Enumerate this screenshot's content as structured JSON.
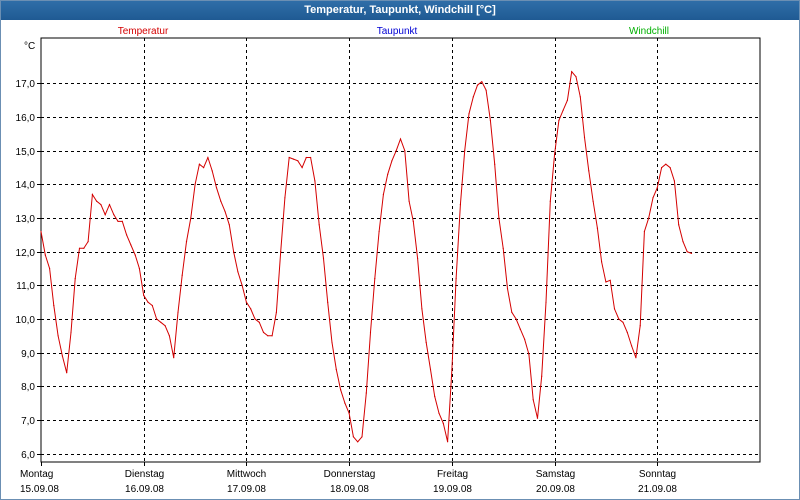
{
  "window": {
    "title": "Temperatur, Taupunkt, Windchill [°C]"
  },
  "chart_data": {
    "type": "line",
    "title": "Temperatur, Taupunkt, Windchill [°C]",
    "ylabel": "°C",
    "ylim": [
      5.75,
      18.35
    ],
    "yticks": [
      "6,0",
      "7,0",
      "8,0",
      "9,0",
      "10,0",
      "11,0",
      "12,0",
      "13,0",
      "14,0",
      "15,0",
      "16,0",
      "17,0"
    ],
    "xlim": [
      0,
      168
    ],
    "xticks": [
      {
        "day": "Montag",
        "date": "15.09.08",
        "x": 0
      },
      {
        "day": "Dienstag",
        "date": "16.09.08",
        "x": 24
      },
      {
        "day": "Mittwoch",
        "date": "17.09.08",
        "x": 48
      },
      {
        "day": "Donnerstag",
        "date": "18.09.08",
        "x": 72
      },
      {
        "day": "Freitag",
        "date": "19.09.08",
        "x": 96
      },
      {
        "day": "Samstag",
        "date": "20.09.08",
        "x": 120
      },
      {
        "day": "Sonntag",
        "date": "21.09.08",
        "x": 144
      }
    ],
    "grid": true,
    "legend": [
      {
        "label": "Temperatur",
        "color": "#d40000"
      },
      {
        "label": "Taupunkt",
        "color": "#0000d4"
      },
      {
        "label": "Windchill",
        "color": "#00b000"
      }
    ],
    "series": [
      {
        "name": "Temperatur",
        "color": "#d40000",
        "points": [
          [
            0,
            12.6
          ],
          [
            1,
            11.9
          ],
          [
            2,
            11.5
          ],
          [
            3,
            10.4
          ],
          [
            4,
            9.5
          ],
          [
            5,
            8.9
          ],
          [
            6,
            8.4
          ],
          [
            7,
            9.6
          ],
          [
            8,
            11.2
          ],
          [
            9,
            12.1
          ],
          [
            10,
            12.1
          ],
          [
            11,
            12.3
          ],
          [
            12,
            13.7
          ],
          [
            13,
            13.5
          ],
          [
            14,
            13.4
          ],
          [
            15,
            13.1
          ],
          [
            16,
            13.4
          ],
          [
            17,
            13.1
          ],
          [
            18,
            12.9
          ],
          [
            19,
            12.9
          ],
          [
            20,
            12.5
          ],
          [
            21,
            12.2
          ],
          [
            22,
            11.9
          ],
          [
            23,
            11.5
          ],
          [
            24,
            10.7
          ],
          [
            25,
            10.5
          ],
          [
            26,
            10.4
          ],
          [
            27,
            10.0
          ],
          [
            28,
            9.9
          ],
          [
            29,
            9.8
          ],
          [
            30,
            9.5
          ],
          [
            31,
            8.85
          ],
          [
            32,
            10.2
          ],
          [
            33,
            11.3
          ],
          [
            34,
            12.3
          ],
          [
            35,
            13.0
          ],
          [
            36,
            14.0
          ],
          [
            37,
            14.6
          ],
          [
            38,
            14.5
          ],
          [
            39,
            14.8
          ],
          [
            40,
            14.4
          ],
          [
            41,
            13.9
          ],
          [
            42,
            13.5
          ],
          [
            43,
            13.2
          ],
          [
            44,
            12.8
          ],
          [
            45,
            12.0
          ],
          [
            46,
            11.4
          ],
          [
            47,
            11.0
          ],
          [
            48,
            10.5
          ],
          [
            49,
            10.3
          ],
          [
            50,
            10.0
          ],
          [
            51,
            9.9
          ],
          [
            52,
            9.6
          ],
          [
            53,
            9.5
          ],
          [
            54,
            9.5
          ],
          [
            55,
            10.2
          ],
          [
            56,
            12.0
          ],
          [
            57,
            13.6
          ],
          [
            58,
            14.8
          ],
          [
            59,
            14.75
          ],
          [
            60,
            14.7
          ],
          [
            61,
            14.5
          ],
          [
            62,
            14.8
          ],
          [
            63,
            14.8
          ],
          [
            64,
            14.1
          ],
          [
            65,
            12.8
          ],
          [
            66,
            11.8
          ],
          [
            67,
            10.5
          ],
          [
            68,
            9.3
          ],
          [
            69,
            8.5
          ],
          [
            70,
            7.9
          ],
          [
            71,
            7.5
          ],
          [
            72,
            7.2
          ],
          [
            73,
            6.5
          ],
          [
            74,
            6.35
          ],
          [
            75,
            6.5
          ],
          [
            76,
            7.8
          ],
          [
            77,
            9.6
          ],
          [
            78,
            11.2
          ],
          [
            79,
            12.6
          ],
          [
            80,
            13.7
          ],
          [
            81,
            14.3
          ],
          [
            82,
            14.7
          ],
          [
            83,
            15.0
          ],
          [
            84,
            15.35
          ],
          [
            85,
            15.0
          ],
          [
            86,
            13.5
          ],
          [
            87,
            12.9
          ],
          [
            88,
            11.8
          ],
          [
            89,
            10.3
          ],
          [
            90,
            9.3
          ],
          [
            91,
            8.5
          ],
          [
            92,
            7.7
          ],
          [
            93,
            7.2
          ],
          [
            94,
            6.9
          ],
          [
            95,
            6.35
          ],
          [
            96,
            8.5
          ],
          [
            97,
            11.2
          ],
          [
            98,
            13.4
          ],
          [
            99,
            15.0
          ],
          [
            100,
            16.1
          ],
          [
            101,
            16.6
          ],
          [
            102,
            16.95
          ],
          [
            103,
            17.05
          ],
          [
            104,
            16.8
          ],
          [
            105,
            15.9
          ],
          [
            106,
            14.6
          ],
          [
            107,
            13.0
          ],
          [
            108,
            12.1
          ],
          [
            109,
            10.9
          ],
          [
            110,
            10.2
          ],
          [
            111,
            10.0
          ],
          [
            112,
            9.7
          ],
          [
            113,
            9.4
          ],
          [
            114,
            8.95
          ],
          [
            115,
            7.6
          ],
          [
            116,
            7.05
          ],
          [
            117,
            8.3
          ],
          [
            118,
            10.5
          ],
          [
            119,
            13.5
          ],
          [
            120,
            14.9
          ],
          [
            121,
            15.9
          ],
          [
            122,
            16.2
          ],
          [
            123,
            16.5
          ],
          [
            124,
            17.35
          ],
          [
            125,
            17.2
          ],
          [
            126,
            16.6
          ],
          [
            127,
            15.4
          ],
          [
            128,
            14.4
          ],
          [
            129,
            13.5
          ],
          [
            130,
            12.7
          ],
          [
            131,
            11.7
          ],
          [
            132,
            11.1
          ],
          [
            133,
            11.15
          ],
          [
            134,
            10.3
          ],
          [
            135,
            10.0
          ],
          [
            136,
            9.9
          ],
          [
            137,
            9.6
          ],
          [
            138,
            9.2
          ],
          [
            139,
            8.85
          ],
          [
            140,
            9.8
          ],
          [
            141,
            12.6
          ],
          [
            142,
            13.0
          ],
          [
            143,
            13.6
          ],
          [
            144,
            13.9
          ],
          [
            145,
            14.5
          ],
          [
            146,
            14.6
          ],
          [
            147,
            14.5
          ],
          [
            148,
            14.1
          ],
          [
            149,
            12.8
          ],
          [
            150,
            12.3
          ],
          [
            151,
            12.0
          ],
          [
            152,
            11.95
          ]
        ]
      }
    ]
  }
}
